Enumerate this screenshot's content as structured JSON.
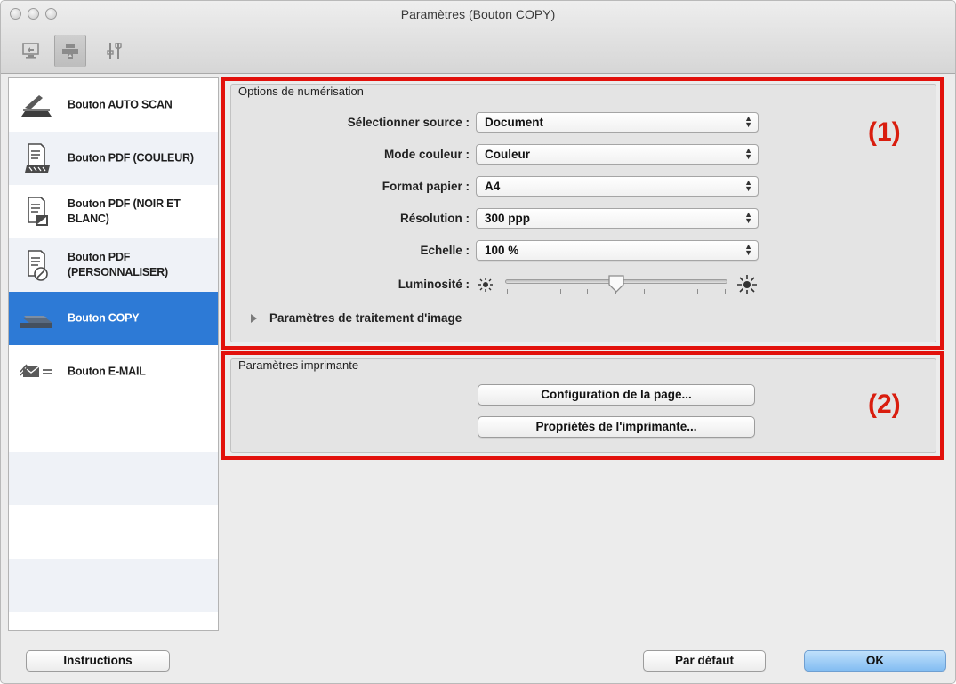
{
  "window": {
    "title": "Paramètres (Bouton COPY)"
  },
  "toolbar": {
    "tabs": [
      {
        "icon": "computer-scan-icon",
        "selected": false
      },
      {
        "icon": "printer-scan-icon",
        "selected": true
      },
      {
        "icon": "general-settings-icon",
        "selected": false
      }
    ]
  },
  "sidebar": {
    "items": [
      {
        "label": "Bouton AUTO SCAN",
        "icon": "auto-scan-icon",
        "selected": false
      },
      {
        "label": "Bouton PDF (COULEUR)",
        "icon": "pdf-color-icon",
        "selected": false
      },
      {
        "label": "Bouton PDF (NOIR ET BLANC)",
        "icon": "pdf-bw-icon",
        "selected": false
      },
      {
        "label": "Bouton PDF (PERSONNALISER)",
        "icon": "pdf-custom-icon",
        "selected": false
      },
      {
        "label": "Bouton COPY",
        "icon": "copy-icon",
        "selected": true
      },
      {
        "label": "Bouton E-MAIL",
        "icon": "email-icon",
        "selected": false
      }
    ]
  },
  "scan_options": {
    "title": "Options de numérisation",
    "callout": "(1)",
    "fields": [
      {
        "label": "Sélectionner source :",
        "value": "Document"
      },
      {
        "label": "Mode couleur :",
        "value": "Couleur"
      },
      {
        "label": "Format papier :",
        "value": "A4"
      },
      {
        "label": "Résolution :",
        "value": "300 ppp"
      },
      {
        "label": "Echelle :",
        "value": "100 %"
      }
    ],
    "brightness": {
      "label": "Luminosité :",
      "value_fraction": 0.5,
      "min_icon": "sun-dim-icon",
      "max_icon": "sun-bright-icon"
    },
    "image_processing": "Paramètres de traitement d'image"
  },
  "printer_settings": {
    "title": "Paramètres imprimante",
    "callout": "(2)",
    "page_setup_label": "Configuration de la page...",
    "printer_properties_label": "Propriétés de l'imprimante..."
  },
  "footer": {
    "instructions_label": "Instructions",
    "default_label": "Par défaut",
    "ok_label": "OK"
  },
  "colors": {
    "selection": "#2d7ad6",
    "callout_red": "#e2110c",
    "default_button": "#83bdf2"
  }
}
